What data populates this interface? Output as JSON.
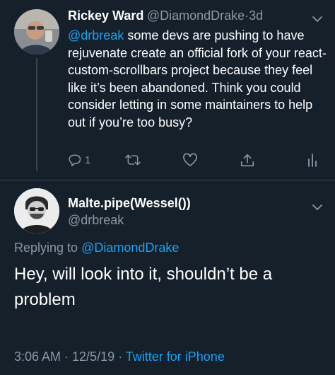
{
  "tweet1": {
    "name": "Rickey Ward",
    "handle": "@DiamondDrake",
    "dot": "·",
    "time": "3d",
    "mention": "@drbreak",
    "text": " some devs are pushing to have rejuvenate create an official fork of your react-custom-scrollbars project because they feel like it’s been abandoned. Think you could consider letting in some maintainers to help out if you’re too busy?",
    "reply_count": "1"
  },
  "tweet2": {
    "name": "Malte.pipe(Wessel())",
    "handle": "@drbreak",
    "replying_prefix": "Replying to ",
    "replying_to": "@DiamondDrake",
    "text": "Hey, will look into it, shouldn’t be a problem",
    "timestamp": "3:06 AM · 12/5/19 · ",
    "source": "Twitter for iPhone"
  },
  "icons": [
    "reply-icon",
    "retweet-icon",
    "like-icon",
    "share-icon",
    "analytics-icon",
    "chevron-down-icon"
  ],
  "colors": {
    "background": "#15202b",
    "text": "#ffffff",
    "secondary": "#8899a6",
    "accent": "#1da1f2",
    "divider": "#38444d"
  }
}
